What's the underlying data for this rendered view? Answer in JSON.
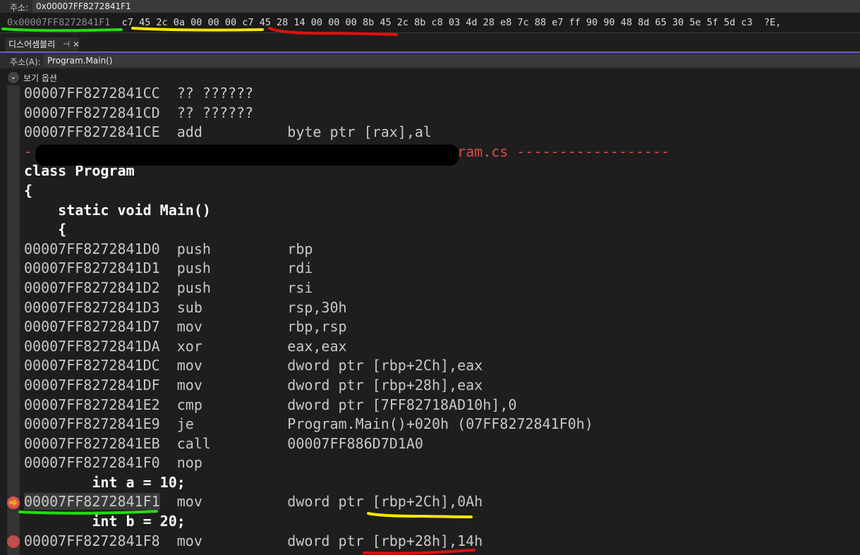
{
  "memory": {
    "address_label": "주소:",
    "address_value": "0x00007FF8272841F1",
    "hex_address": "0x00007FF8272841F1",
    "hex_bytes": "c7 45 2c 0a 00 00 00 c7 45 28 14 00 00 00 8b 45 2c 8b c8 03 4d 28 e8 7c 88 e7 ff 90 90 48 8d 65 30 5e 5f 5d c3",
    "ascii": "?E,"
  },
  "disassembly": {
    "tab_label": "디스어셈블리",
    "pin_icon": "pin-icon",
    "close_icon": "close-icon",
    "address_label": "주소(A):",
    "address_value": "Program.Main()",
    "view_options": "보기 옵션",
    "lines": [
      {
        "type": "asm",
        "text": "00007FF8272841CC  ?? ??????"
      },
      {
        "type": "asm",
        "text": "00007FF8272841CD  ?? ??????"
      },
      {
        "type": "asm",
        "text": "00007FF8272841CE  add          byte ptr [rax],al"
      },
      {
        "type": "sep",
        "text": "--                                            \\Program.cs ------------------"
      },
      {
        "type": "src",
        "text": "class Program"
      },
      {
        "type": "src",
        "text": "{"
      },
      {
        "type": "src",
        "text": "    static void Main()"
      },
      {
        "type": "src",
        "text": "    {"
      },
      {
        "type": "asm",
        "text": "00007FF8272841D0  push         rbp"
      },
      {
        "type": "asm",
        "text": "00007FF8272841D1  push         rdi"
      },
      {
        "type": "asm",
        "text": "00007FF8272841D2  push         rsi"
      },
      {
        "type": "asm",
        "text": "00007FF8272841D3  sub          rsp,30h"
      },
      {
        "type": "asm",
        "text": "00007FF8272841D7  mov          rbp,rsp"
      },
      {
        "type": "asm",
        "text": "00007FF8272841DA  xor          eax,eax"
      },
      {
        "type": "asm",
        "text": "00007FF8272841DC  mov          dword ptr [rbp+2Ch],eax"
      },
      {
        "type": "asm",
        "text": "00007FF8272841DF  mov          dword ptr [rbp+28h],eax"
      },
      {
        "type": "asm",
        "text": "00007FF8272841E2  cmp          dword ptr [7FF82718AD10h],0"
      },
      {
        "type": "asm",
        "text": "00007FF8272841E9  je           Program.Main()+020h (07FF8272841F0h)"
      },
      {
        "type": "asm",
        "text": "00007FF8272841EB  call         00007FF886D7D1A0"
      },
      {
        "type": "asm",
        "text": "00007FF8272841F0  nop"
      },
      {
        "type": "src",
        "text": "        int a = 10;"
      },
      {
        "type": "asm",
        "text": "00007FF8272841F1  mov          dword ptr [rbp+2Ch],0Ah",
        "current": true
      },
      {
        "type": "src",
        "text": "        int b = 20;"
      },
      {
        "type": "asm",
        "text": "00007FF8272841F8  mov          dword ptr [rbp+28h],14h",
        "breakpoint": true
      }
    ]
  },
  "annotation_colors": {
    "green": "#22dd11",
    "yellow": "#ffe600",
    "red": "#e01010"
  }
}
